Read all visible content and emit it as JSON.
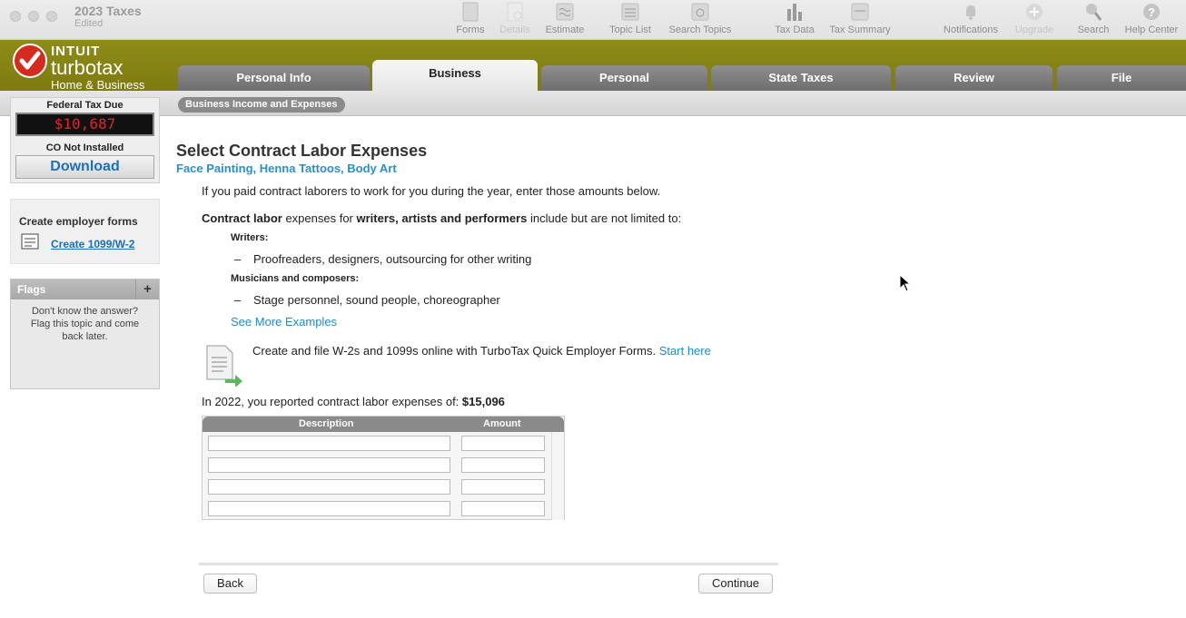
{
  "window": {
    "title": "2023 Taxes",
    "subtitle": "Edited"
  },
  "toolbar": {
    "items": [
      {
        "label": "Forms",
        "icon": "forms-icon"
      },
      {
        "label": "Details",
        "icon": "details-icon"
      },
      {
        "label": "Estimate",
        "icon": "estimate-icon"
      },
      {
        "label": "Topic List",
        "icon": "topic-list-icon"
      },
      {
        "label": "Search Topics",
        "icon": "search-topics-icon"
      },
      {
        "label": "Tax Data",
        "icon": "tax-data-icon"
      },
      {
        "label": "Tax Summary",
        "icon": "tax-summary-icon"
      },
      {
        "label": "Notifications",
        "icon": "bell-icon"
      },
      {
        "label": "Upgrade",
        "icon": "upgrade-icon"
      },
      {
        "label": "Search",
        "icon": "search-icon"
      },
      {
        "label": "Help Center",
        "icon": "help-icon"
      }
    ]
  },
  "brand": {
    "intuit": "INTUIT",
    "product": "turbotax",
    "edition": "Home & Business"
  },
  "tabs": [
    "Personal Info",
    "Business",
    "Personal",
    "State Taxes",
    "Review",
    "File"
  ],
  "active_tab": "Business",
  "breadcrumb": "Business Income and Expenses",
  "sidebar": {
    "federal_label": "Federal Tax Due",
    "federal_value": "$10,687",
    "state_label": "CO Not Installed",
    "download_label": "Download",
    "employer_heading": "Create employer forms",
    "employer_link": "Create 1099/W-2",
    "flags_title": "Flags",
    "flags_plus": "+",
    "flags_text": "Don't know the answer? Flag this topic and come back later."
  },
  "main": {
    "title": "Select Contract Labor Expenses",
    "subtitle": "Face Painting, Henna Tattoos, Body Art",
    "intro": "If you paid contract laborers to work for you during the year, enter those amounts below.",
    "desc": {
      "b1": "Contract labor",
      "t1": " expenses for ",
      "b2": "writers, artists and performers",
      "t2": " include but are not limited to:"
    },
    "writers_label": "Writers:",
    "writers_item": "Proofreaders, designers, outsourcing for other writing",
    "musicians_label": "Musicians and composers:",
    "musicians_item": "Stage personnel, sound people, choreographer",
    "dash": "–",
    "see_more": "See More Examples",
    "forms_text": "Create and file W-2s and 1099s online with TurboTax Quick Employer Forms.",
    "start_here": "Start here",
    "prior_text": "In 2022, you reported contract labor expenses of:",
    "prior_amount": "$15,096",
    "table": {
      "col_description": "Description",
      "col_amount": "Amount",
      "rows": [
        {
          "description": "",
          "amount": ""
        },
        {
          "description": "",
          "amount": ""
        },
        {
          "description": "",
          "amount": ""
        },
        {
          "description": "",
          "amount": ""
        }
      ]
    },
    "back_label": "Back",
    "continue_label": "Continue"
  }
}
